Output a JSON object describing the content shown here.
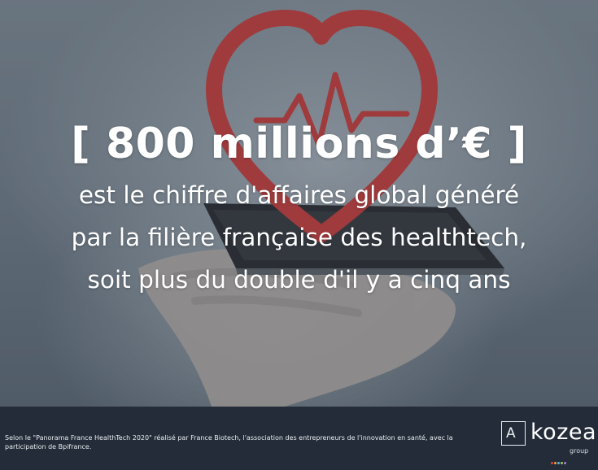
{
  "headline": {
    "amount": "[ 800 millions d’€ ]",
    "lines": [
      "est le chiffre d'affaires global généré",
      "par la filière française des healthtech,",
      "soit plus du double d'il y a cinq ans"
    ]
  },
  "footer": {
    "source": "Selon le \"Panorama France HealthTech 2020\" réalisé par France Biotech, l'association des entrepreneurs de l'innovation en santé, avec la participation de Bpifrance."
  },
  "logo": {
    "mark": "A",
    "word": "kozea",
    "sub": "group",
    "dot_colors": [
      "#e8433c",
      "#f2a33a",
      "#57b5e6",
      "#8fcf5a",
      "#b57adf"
    ]
  },
  "colors": {
    "heart": "#d0312d",
    "footer_bg": "#232c38",
    "text": "#ffffff"
  },
  "icons": [
    "heart-icon",
    "heartbeat-line-icon",
    "smartphone-icon",
    "hand-icon"
  ]
}
